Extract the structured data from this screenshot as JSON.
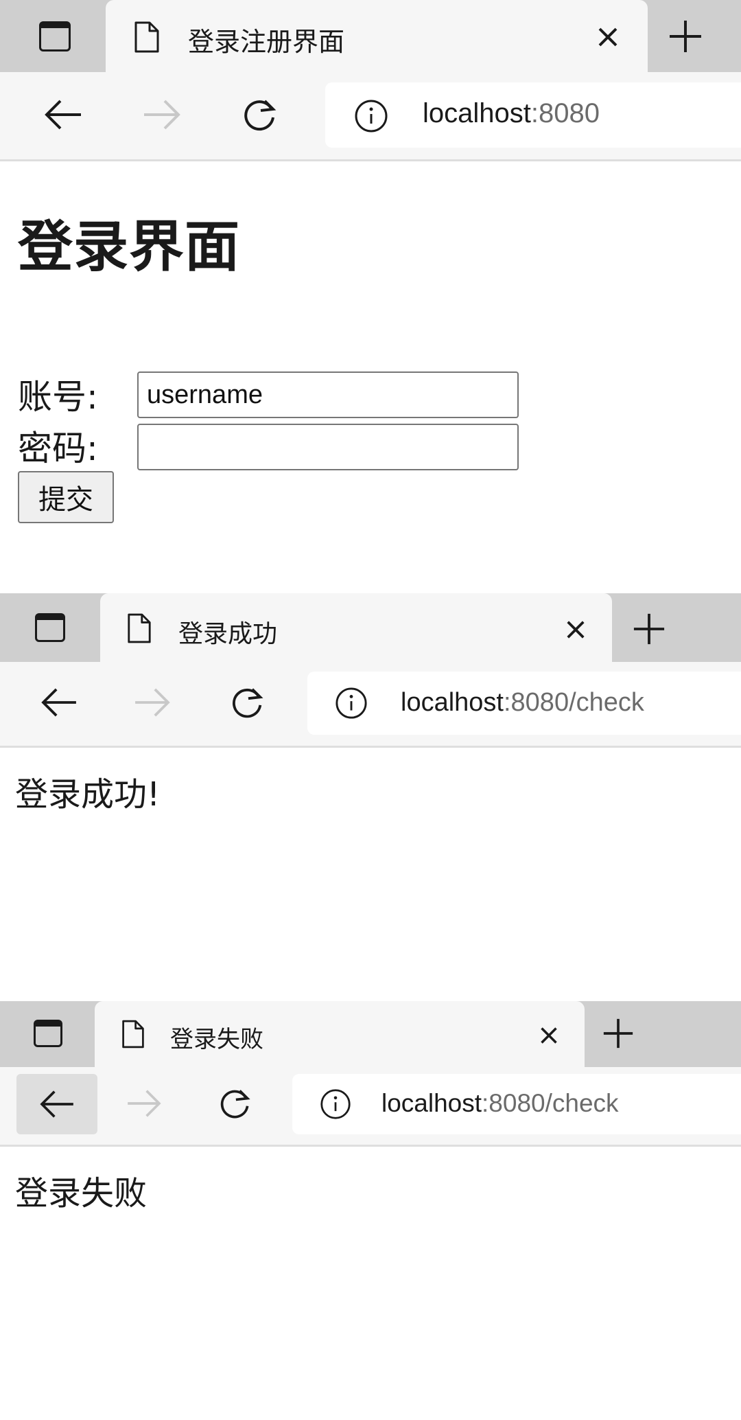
{
  "screenshots": [
    {
      "tab_title": "登录注册界面",
      "url_host": "localhost",
      "url_rest": ":8080",
      "page": {
        "heading": "登录界面",
        "username_label": "账号:",
        "username_value": "username",
        "password_label": "密码:",
        "password_value": "",
        "submit_label": "提交"
      }
    },
    {
      "tab_title": "登录成功",
      "url_host": "localhost",
      "url_rest": ":8080/check",
      "page": {
        "message": "登录成功!"
      }
    },
    {
      "tab_title": "登录失败",
      "url_host": "localhost",
      "url_rest": ":8080/check",
      "page": {
        "message": "登录失败"
      }
    }
  ],
  "icons": {
    "tab_toggle": "tab-actions-icon",
    "tab_page": "page-icon",
    "close": "close-icon",
    "new_tab": "plus-icon",
    "back": "arrow-left-icon",
    "forward": "arrow-right-icon",
    "reload": "reload-icon",
    "site_info": "info-icon"
  },
  "colors": {
    "tabstrip": "#cfcfcf",
    "active_tab": "#f6f6f6",
    "url_muted": "#6b6b6b",
    "disabled_icon": "#c8c8c8"
  }
}
